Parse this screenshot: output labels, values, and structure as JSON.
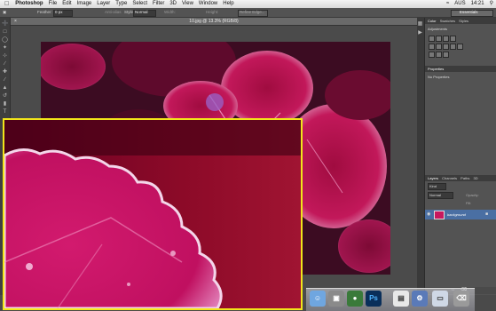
{
  "menubar": {
    "app_name": "Photoshop",
    "items": [
      "File",
      "Edit",
      "Image",
      "Layer",
      "Type",
      "Select",
      "Filter",
      "3D",
      "View",
      "Window",
      "Help"
    ],
    "status": {
      "battery": "AUS",
      "clock": "14:21"
    }
  },
  "options_bar": {
    "feather_label": "Feather:",
    "feather_value": "0 px",
    "antialias_label": "Anti-alias",
    "style_label": "Style:",
    "style_value": "Normal",
    "width_label": "Width:",
    "height_label": "Height:",
    "refine_label": "Refine Edge...",
    "workspace_value": "Essentials"
  },
  "document": {
    "tab_title": "10.jpg @ 13.3% (RGB/8)"
  },
  "panels": {
    "top_tabs": [
      "Color",
      "Swatches",
      "Styles"
    ],
    "adjustments_label": "Adjustments",
    "properties_label": "Properties",
    "no_properties": "No Properties",
    "layers_tabs": [
      "Layers",
      "Channels",
      "Paths",
      "3D"
    ],
    "kind_value": "Kind",
    "blend_value": "Normal",
    "opacity_label": "Opacity:",
    "fill_label": "Fill:",
    "layer_name": "background"
  },
  "colors": {
    "zoom_border": "#f2e51a",
    "photo_magenta": "#c8185e",
    "layer_selected": "#4a6fa3"
  },
  "dock": {
    "icons": [
      "finder-icon",
      "preview-icon",
      "camera-icon",
      "photoshop-icon",
      "document-icon",
      "settings-icon",
      "trash-icon"
    ],
    "ps_label": "Ps"
  }
}
